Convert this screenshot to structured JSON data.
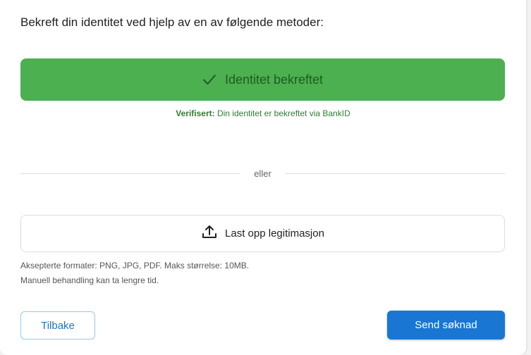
{
  "header": {
    "title": "Bekreft din identitet ved hjelp av en av følgende metoder:"
  },
  "bankid": {
    "button_label": "Identitet bekreftet",
    "icon": "check-icon",
    "status_prefix": "Verifisert:",
    "status_text": "Din identitet er bekreftet via BankID"
  },
  "divider": {
    "label": "eller"
  },
  "upload": {
    "button_label": "Last opp legitimasjon",
    "icon": "upload-icon",
    "help_line_1": "Aksepterte formater: PNG, JPG, PDF. Maks størrelse: 10MB.",
    "help_line_2": "Manuell behandling kan ta lengre tid."
  },
  "footer": {
    "back_label": "Tilbake",
    "submit_label": "Send søknad"
  },
  "colors": {
    "success": "#4caf50",
    "success_text": "#1b5e20",
    "primary": "#1976d2"
  }
}
